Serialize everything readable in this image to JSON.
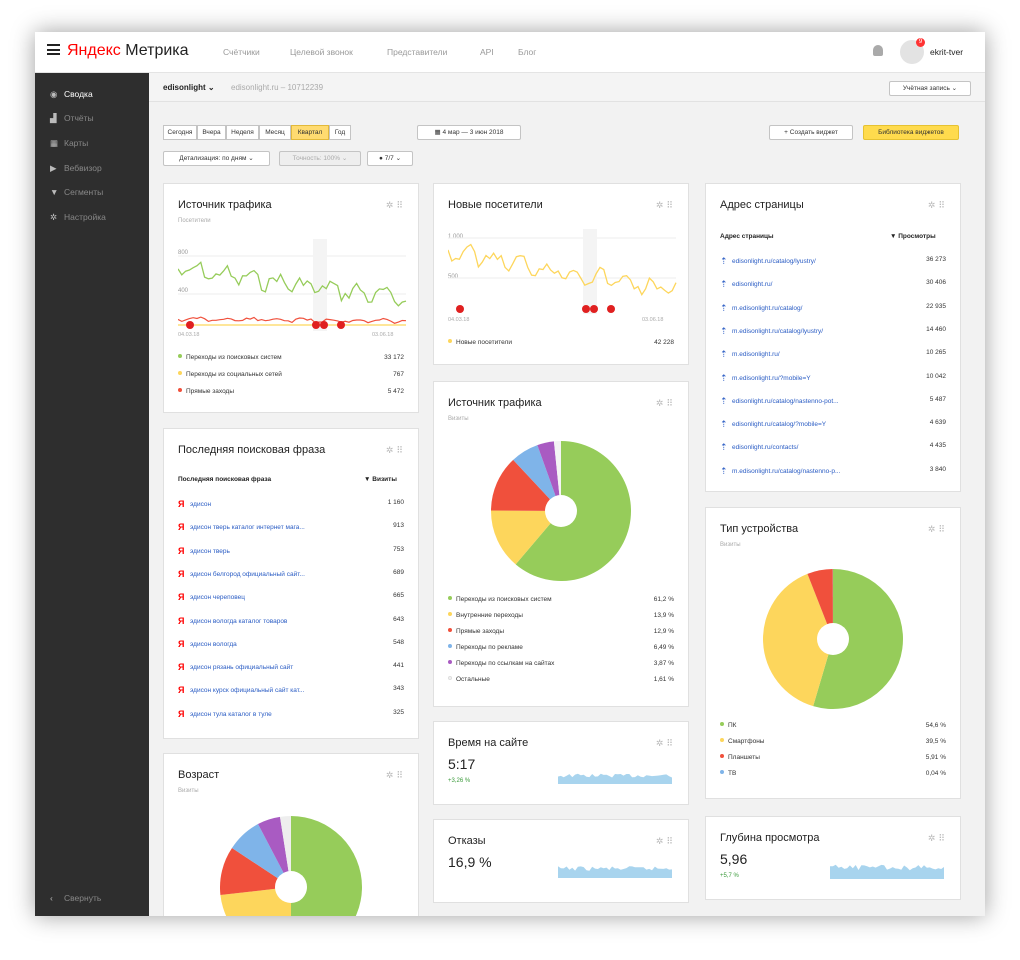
{
  "app": {
    "logo_ya": "Яндекс",
    "logo_name": "Метрика",
    "user": "ekrit-tver",
    "notifications": "9"
  },
  "topnav": [
    "Счётчики",
    "Целевой звонок",
    "Представители",
    "API",
    "Блог"
  ],
  "sidebar": {
    "items": [
      {
        "icon": "eye-icon",
        "glyph": "◉",
        "label": "Сводка",
        "active": true
      },
      {
        "icon": "reports-icon",
        "glyph": "▟",
        "label": "Отчёты"
      },
      {
        "icon": "maps-icon",
        "glyph": "▦",
        "label": "Карты"
      },
      {
        "icon": "webvisor-icon",
        "glyph": "▶",
        "label": "Вебвизор"
      },
      {
        "icon": "segments-icon",
        "glyph": "▼",
        "label": "Сегменты"
      },
      {
        "icon": "settings-icon",
        "glyph": "✲",
        "label": "Настройка"
      }
    ],
    "collapse": "Свернуть"
  },
  "breadcrumb": {
    "counter": "edisonlight",
    "site": "edisonlight.ru – 10712239",
    "account": "Учётная запись"
  },
  "toolbar": {
    "periods": [
      "Сегодня",
      "Вчера",
      "Неделя",
      "Месяц",
      "Квартал",
      "Год"
    ],
    "active_period": "Квартал",
    "date_range": "4 мар — 3 июн 2018",
    "create_widget": "Создать виджет",
    "library": "Библиотека виджетов",
    "detail": "Детализация: по дням",
    "accuracy": "Точность: 100%",
    "filter": "7/7"
  },
  "colors": {
    "green": "#96cc5a",
    "yellow": "#fdd65c",
    "red": "#f0503c",
    "blue": "#7fb4e9",
    "purple": "#a95bc2",
    "light": "#f4f4f4",
    "sparkline": "#a8d4ee"
  },
  "w_traffic": {
    "title": "Источник трафика",
    "sub": "Посетители",
    "y_top": "800",
    "y_mid": "400",
    "date_start": "04.03.18",
    "date_end": "03.06.18",
    "legend": [
      {
        "label": "Переходы из поисковых систем",
        "value": "33 172",
        "color": "green"
      },
      {
        "label": "Переходы из социальных сетей",
        "value": "767",
        "color": "yellow"
      },
      {
        "label": "Прямые заходы",
        "value": "5 472",
        "color": "red"
      }
    ]
  },
  "w_newvis": {
    "title": "Новые посетители",
    "y_top": "1 000",
    "y_mid": "500",
    "date_start": "04.03.18",
    "date_end": "03.06.18",
    "legend": [
      {
        "label": "Новые посетители",
        "value": "42 228",
        "color": "yellow"
      }
    ]
  },
  "w_address": {
    "title": "Адрес страницы",
    "col1": "Адрес страницы",
    "col2": "Просмотры",
    "rows": [
      {
        "url": "edisonlight.ru/catalog/lyustry/",
        "value": "36 273"
      },
      {
        "url": "edisonlight.ru/",
        "value": "30 406"
      },
      {
        "url": "m.edisonlight.ru/catalog/",
        "value": "22 935"
      },
      {
        "url": "m.edisonlight.ru/catalog/lyustry/",
        "value": "14 460"
      },
      {
        "url": "m.edisonlight.ru/",
        "value": "10 265"
      },
      {
        "url": "m.edisonlight.ru/?mobile=Y",
        "value": "10 042"
      },
      {
        "url": "edisonlight.ru/catalog/nastenno-pot...",
        "value": "5 487"
      },
      {
        "url": "edisonlight.ru/catalog/?mobile=Y",
        "value": "4 639"
      },
      {
        "url": "edisonlight.ru/contacts/",
        "value": "4 435"
      },
      {
        "url": "m.edisonlight.ru/catalog/nastenno-p...",
        "value": "3 840"
      }
    ]
  },
  "w_search": {
    "title": "Последняя поисковая фраза",
    "col1": "Последняя поисковая фраза",
    "col2": "Визиты",
    "rows": [
      {
        "phrase": "эдисон",
        "value": "1 160"
      },
      {
        "phrase": "эдисон тверь каталог интернет мага...",
        "value": "913"
      },
      {
        "phrase": "эдисон тверь",
        "value": "753"
      },
      {
        "phrase": "эдисон белгород официальный сайт...",
        "value": "689"
      },
      {
        "phrase": "эдисон череповец",
        "value": "665"
      },
      {
        "phrase": "эдисон вологда каталог товаров",
        "value": "643"
      },
      {
        "phrase": "эдисон вологда",
        "value": "548"
      },
      {
        "phrase": "эдисон рязань официальный сайт",
        "value": "441"
      },
      {
        "phrase": "эдисон курск официальный сайт кат...",
        "value": "343"
      },
      {
        "phrase": "эдисон тула каталог в туле",
        "value": "325"
      }
    ]
  },
  "w_traffic_pie": {
    "title": "Источник трафика",
    "sub": "Визиты",
    "legend": [
      {
        "label": "Переходы из поисковых систем",
        "value": "61,2 %",
        "pct": 61.2,
        "color": "green"
      },
      {
        "label": "Внутренние переходы",
        "value": "13,9 %",
        "pct": 13.9,
        "color": "yellow"
      },
      {
        "label": "Прямые заходы",
        "value": "12,9 %",
        "pct": 12.9,
        "color": "red"
      },
      {
        "label": "Переходы по рекламе",
        "value": "6,49 %",
        "pct": 6.49,
        "color": "blue"
      },
      {
        "label": "Переходы по ссылкам на сайтах",
        "value": "3,87 %",
        "pct": 3.87,
        "color": "purple"
      },
      {
        "label": "Остальные",
        "value": "1,61 %",
        "pct": 1.61,
        "color": "light"
      }
    ]
  },
  "w_device": {
    "title": "Тип устройства",
    "sub": "Визиты",
    "legend": [
      {
        "label": "ПК",
        "value": "54,6 %",
        "pct": 54.6,
        "color": "green"
      },
      {
        "label": "Смартфоны",
        "value": "39,5 %",
        "pct": 39.5,
        "color": "yellow"
      },
      {
        "label": "Планшеты",
        "value": "5,91 %",
        "pct": 5.91,
        "color": "red"
      },
      {
        "label": "ТВ",
        "value": "0,04 %",
        "pct": 0.04,
        "color": "blue"
      }
    ]
  },
  "w_age": {
    "title": "Возраст",
    "sub": "Визиты"
  },
  "w_time": {
    "title": "Время на сайте",
    "value": "5:17",
    "delta": "+3,26 %"
  },
  "w_bounce": {
    "title": "Отказы",
    "value": "16,9 %"
  },
  "w_depth": {
    "title": "Глубина просмотра",
    "value": "5,96",
    "delta": "+5,7 %"
  }
}
